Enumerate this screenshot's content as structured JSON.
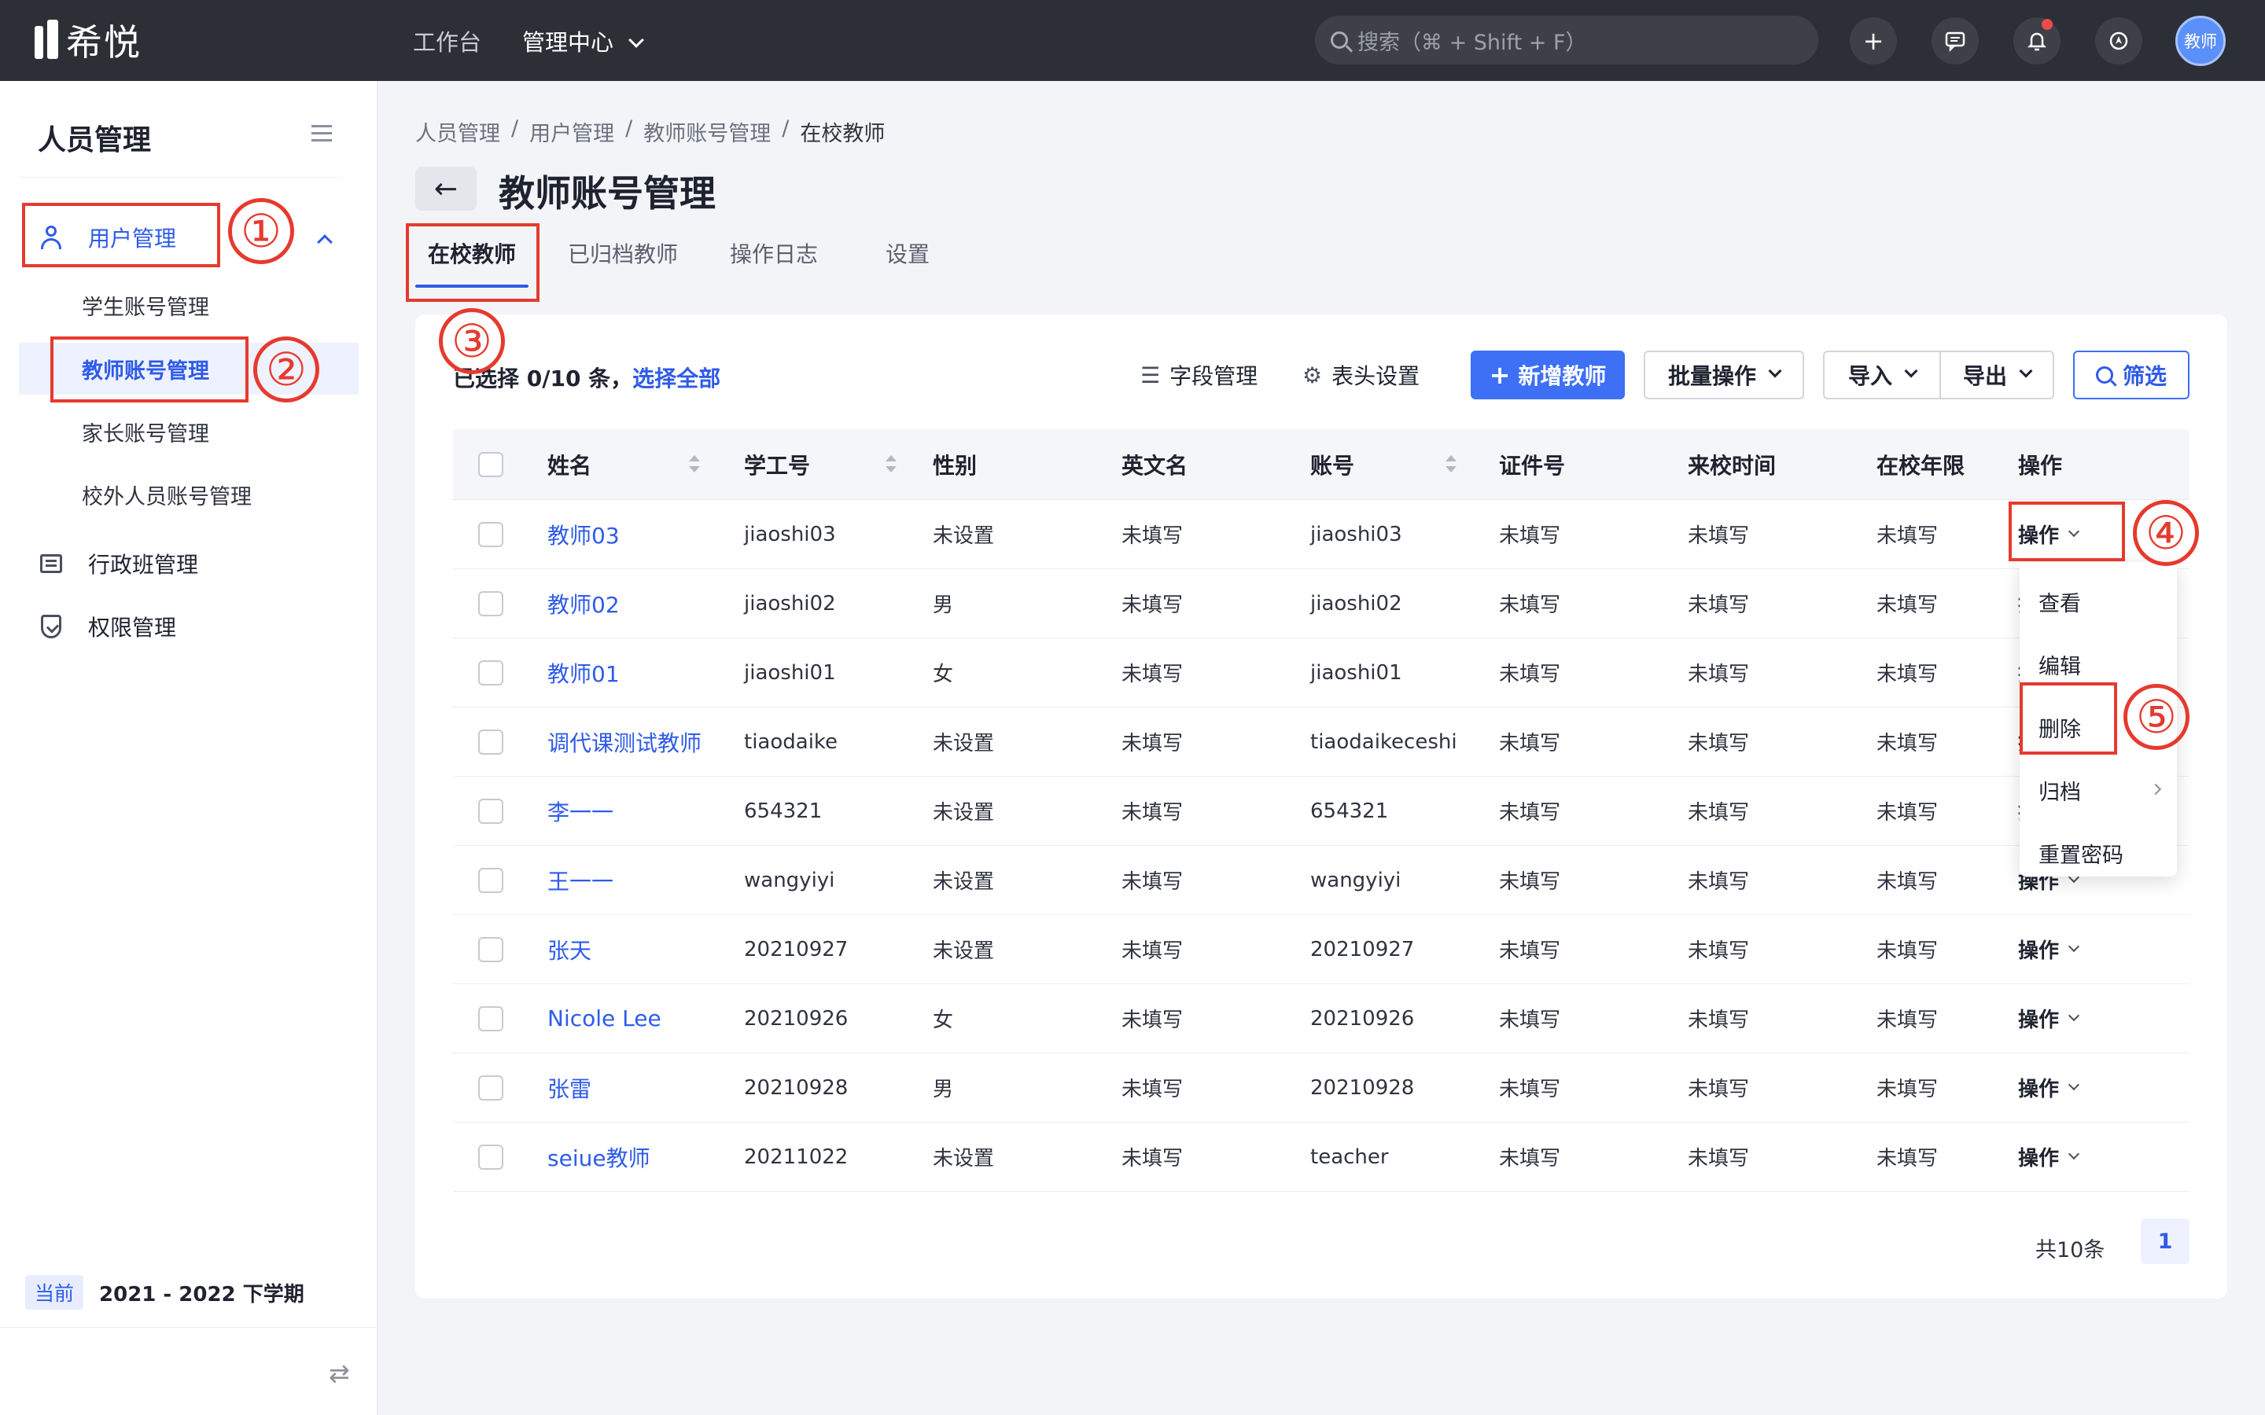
{
  "app": {
    "logo_text": "希悦"
  },
  "topnav": {
    "items": [
      {
        "label": "工作台"
      },
      {
        "label": "管理中心"
      }
    ],
    "search_placeholder": "搜索（⌘ + Shift + F）",
    "avatar_label": "教师"
  },
  "sidebar": {
    "title": "人员管理",
    "user_mgmt": "用户管理",
    "subitems": [
      "学生账号管理",
      "教师账号管理",
      "家长账号管理",
      "校外人员账号管理"
    ],
    "class_mgmt": "行政班管理",
    "perm_mgmt": "权限管理",
    "term_badge": "当前",
    "term_text": "2021 - 2022 下学期"
  },
  "breadcrumb": [
    "人员管理",
    "用户管理",
    "教师账号管理",
    "在校教师"
  ],
  "page": {
    "title": "教师账号管理"
  },
  "tabs": [
    "在校教师",
    "已归档教师",
    "操作日志",
    "设置"
  ],
  "toolbar": {
    "selected_prefix": "已选择 0/10 条，",
    "select_all": "选择全部",
    "field_mgmt": "字段管理",
    "header_settings": "表头设置",
    "add_teacher": "新增教师",
    "batch_ops": "批量操作",
    "import": "导入",
    "export": "导出",
    "filter": "筛选"
  },
  "table": {
    "headers": [
      "姓名",
      "学工号",
      "性别",
      "英文名",
      "账号",
      "证件号",
      "来校时间",
      "在校年限",
      "操作"
    ],
    "op_label": "操作",
    "rows": [
      {
        "name": "教师03",
        "id": "jiaoshi03",
        "gender": "未设置",
        "en": "未填写",
        "account": "jiaoshi03",
        "cert": "未填写",
        "date": "未填写",
        "years": "未填写"
      },
      {
        "name": "教师02",
        "id": "jiaoshi02",
        "gender": "男",
        "en": "未填写",
        "account": "jiaoshi02",
        "cert": "未填写",
        "date": "未填写",
        "years": "未填写"
      },
      {
        "name": "教师01",
        "id": "jiaoshi01",
        "gender": "女",
        "en": "未填写",
        "account": "jiaoshi01",
        "cert": "未填写",
        "date": "未填写",
        "years": "未填写"
      },
      {
        "name": "调代课测试教师",
        "id": "tiaodaike",
        "gender": "未设置",
        "en": "未填写",
        "account": "tiaodaikeceshi",
        "cert": "未填写",
        "date": "未填写",
        "years": "未填写"
      },
      {
        "name": "李一一",
        "id": "654321",
        "gender": "未设置",
        "en": "未填写",
        "account": "654321",
        "cert": "未填写",
        "date": "未填写",
        "years": "未填写"
      },
      {
        "name": "王一一",
        "id": "wangyiyi",
        "gender": "未设置",
        "en": "未填写",
        "account": "wangyiyi",
        "cert": "未填写",
        "date": "未填写",
        "years": "未填写"
      },
      {
        "name": "张天",
        "id": "20210927",
        "gender": "未设置",
        "en": "未填写",
        "account": "20210927",
        "cert": "未填写",
        "date": "未填写",
        "years": "未填写"
      },
      {
        "name": "Nicole Lee",
        "id": "20210926",
        "gender": "女",
        "en": "未填写",
        "account": "20210926",
        "cert": "未填写",
        "date": "未填写",
        "years": "未填写"
      },
      {
        "name": "张雷",
        "id": "20210928",
        "gender": "男",
        "en": "未填写",
        "account": "20210928",
        "cert": "未填写",
        "date": "未填写",
        "years": "未填写"
      },
      {
        "name": "seiue教师",
        "id": "20211022",
        "gender": "未设置",
        "en": "未填写",
        "account": "teacher",
        "cert": "未填写",
        "date": "未填写",
        "years": "未填写"
      }
    ]
  },
  "pagination": {
    "total": "共10条",
    "current": "1"
  },
  "dropdown": {
    "items": [
      "查看",
      "编辑",
      "删除",
      "归档",
      "重置密码"
    ]
  },
  "annotations": [
    "①",
    "②",
    "③",
    "④",
    "⑤"
  ]
}
